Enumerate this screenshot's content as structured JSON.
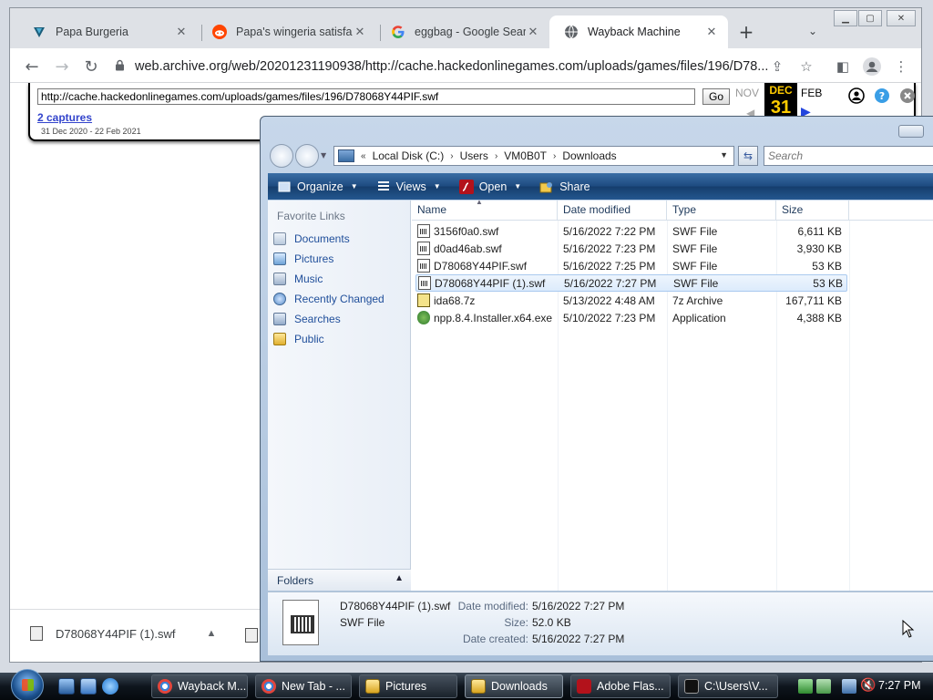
{
  "browser": {
    "tabs": [
      {
        "label": "Papa Burgeria",
        "active": false
      },
      {
        "label": "Papa's wingeria satisfact",
        "active": false
      },
      {
        "label": "eggbag - Google Search",
        "active": false
      },
      {
        "label": "Wayback Machine",
        "active": true
      }
    ],
    "url": "web.archive.org/web/20201231190938/http://cache.hackedonlinegames.com/uploads/games/files/196/D78..."
  },
  "wayback": {
    "url_value": "http://cache.hackedonlinegames.com/uploads/games/files/196/D78068Y44PIF.swf",
    "go_label": "Go",
    "captures_label": "2 captures",
    "range": "31 Dec 2020 - 22 Feb 2021",
    "prev_month": "NOV",
    "cur_month": "DEC",
    "cur_day": "31",
    "next_month": "FEB"
  },
  "download_bar": {
    "item_label": "D78068Y44PIF (1).swf"
  },
  "explorer": {
    "breadcrumb": [
      "Local Disk (C:)",
      "Users",
      "VM0B0T",
      "Downloads"
    ],
    "search_placeholder": "Search",
    "commands": [
      {
        "label": "Organize",
        "icon": "organize-icon"
      },
      {
        "label": "Views",
        "icon": "views-icon"
      },
      {
        "label": "Open",
        "icon": "flash-icon"
      },
      {
        "label": "Share",
        "icon": "share-icon"
      }
    ],
    "nav_heading": "Favorite Links",
    "nav_items": [
      {
        "label": "Documents",
        "icon": "documents-icon"
      },
      {
        "label": "Pictures",
        "icon": "pictures-icon"
      },
      {
        "label": "Music",
        "icon": "music-icon"
      },
      {
        "label": "Recently Changed",
        "icon": "recently-changed-icon"
      },
      {
        "label": "Searches",
        "icon": "searches-icon"
      },
      {
        "label": "Public",
        "icon": "public-folder-icon"
      }
    ],
    "folders_label": "Folders",
    "columns": [
      "Name",
      "Date modified",
      "Type",
      "Size"
    ],
    "files": [
      {
        "name": "3156f0a0.swf",
        "date": "5/16/2022 7:22 PM",
        "type": "SWF File",
        "size": "6,611 KB",
        "kind": "swf",
        "selected": false
      },
      {
        "name": "d0ad46ab.swf",
        "date": "5/16/2022 7:23 PM",
        "type": "SWF File",
        "size": "3,930 KB",
        "kind": "swf",
        "selected": false
      },
      {
        "name": "D78068Y44PIF.swf",
        "date": "5/16/2022 7:25 PM",
        "type": "SWF File",
        "size": "53 KB",
        "kind": "swf",
        "selected": false
      },
      {
        "name": "D78068Y44PIF (1).swf",
        "date": "5/16/2022 7:27 PM",
        "type": "SWF File",
        "size": "53 KB",
        "kind": "swf",
        "selected": true
      },
      {
        "name": "ida68.7z",
        "date": "5/13/2022 4:48 AM",
        "type": "7z Archive",
        "size": "167,711 KB",
        "kind": "zip",
        "selected": false
      },
      {
        "name": "npp.8.4.Installer.x64.exe",
        "date": "5/10/2022 7:23 PM",
        "type": "Application",
        "size": "4,388 KB",
        "kind": "exe",
        "selected": false
      }
    ],
    "details": {
      "name": "D78068Y44PIF (1).swf",
      "type": "SWF File",
      "modified_label": "Date modified:",
      "modified": "5/16/2022 7:27 PM",
      "size_label": "Size:",
      "size": "52.0 KB",
      "created_label": "Date created:",
      "created": "5/16/2022 7:27 PM"
    }
  },
  "taskbar": {
    "buttons": [
      {
        "label": "Wayback M...",
        "icon": "chrome-icon",
        "active": false
      },
      {
        "label": "New Tab - ...",
        "icon": "chrome-icon",
        "active": false
      },
      {
        "label": "Pictures",
        "icon": "folder-icon",
        "active": false
      },
      {
        "label": "Downloads",
        "icon": "folder-icon",
        "active": true
      },
      {
        "label": "Adobe Flas...",
        "icon": "flash-icon",
        "active": false
      },
      {
        "label": "C:\\Users\\V...",
        "icon": "cmd-icon",
        "active": false
      }
    ],
    "clock": "7:27 PM"
  },
  "colors": {
    "chrome_tabstrip": "#dee1e6",
    "explorer_cmdbar": "#1d4a7f",
    "link_blue": "#1f4e9a",
    "taskbar": "#0e151d"
  }
}
